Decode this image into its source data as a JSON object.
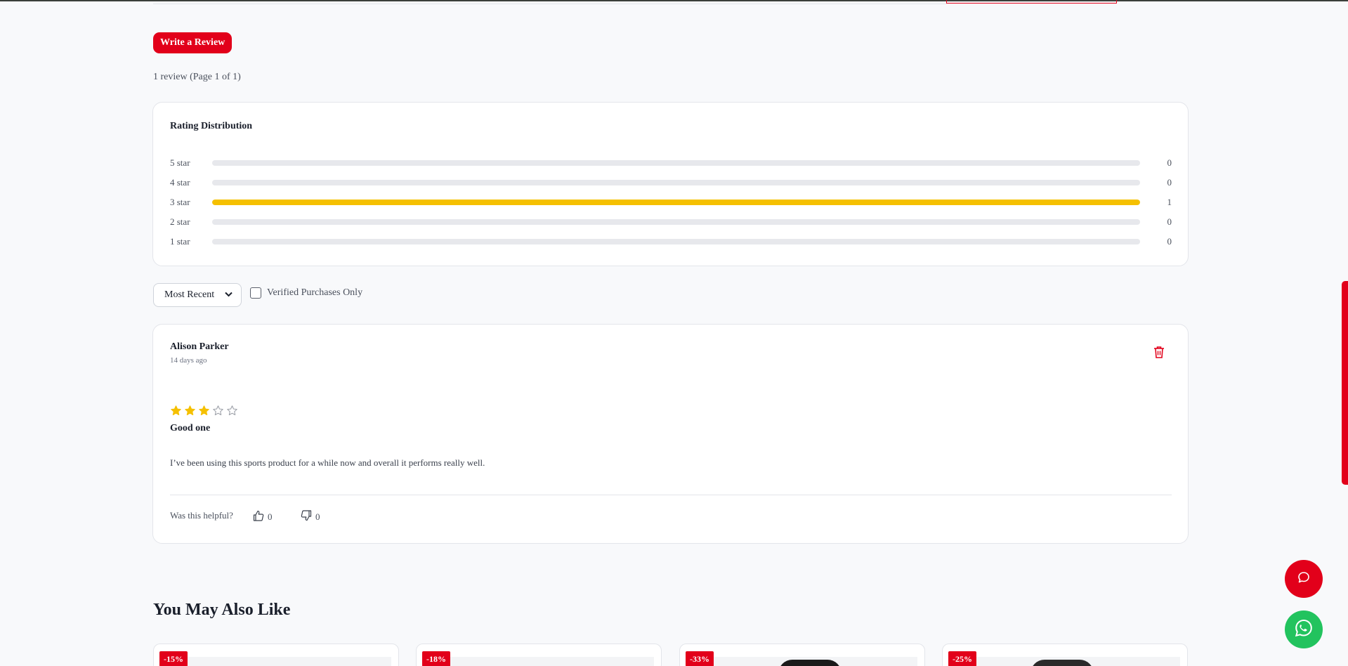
{
  "reviews_section": {
    "write_review_label": "Write a Review",
    "review_count_text": "1 review (Page 1 of 1)"
  },
  "rating_distribution": {
    "title": "Rating Distribution",
    "bar_color": "#f5c000",
    "rows": [
      {
        "label": "5 star",
        "count": "0",
        "fraction": 0
      },
      {
        "label": "4 star",
        "count": "0",
        "fraction": 0
      },
      {
        "label": "3 star",
        "count": "1",
        "fraction": 1
      },
      {
        "label": "2 star",
        "count": "0",
        "fraction": 0
      },
      {
        "label": "1 star",
        "count": "0",
        "fraction": 0
      }
    ]
  },
  "filters": {
    "sort_selected": "Most Recent",
    "verified_label": "Verified Purchases Only",
    "verified_checked": false
  },
  "review": {
    "author": "Alison Parker",
    "date": "14 days ago",
    "rating": 3,
    "max_rating": 5,
    "title": "Good one",
    "body": "I’ve been using this sports product for a while now and overall it performs really well.",
    "helpful_label": "Was this helpful?",
    "helpful_yes_count": "0",
    "helpful_no_count": "0",
    "delete_icon": "trash-icon"
  },
  "related": {
    "heading": "You May Also Like",
    "products": [
      {
        "discount": "-15%"
      },
      {
        "discount": "-18%"
      },
      {
        "discount": "-33%"
      },
      {
        "discount": "-25%"
      }
    ]
  },
  "floating": {
    "chat_icon": "chat-bubble-icon",
    "whatsapp_icon": "whatsapp-icon"
  },
  "colors": {
    "accent": "#e2001a",
    "star": "#f5c000",
    "whatsapp": "#22c35e"
  }
}
